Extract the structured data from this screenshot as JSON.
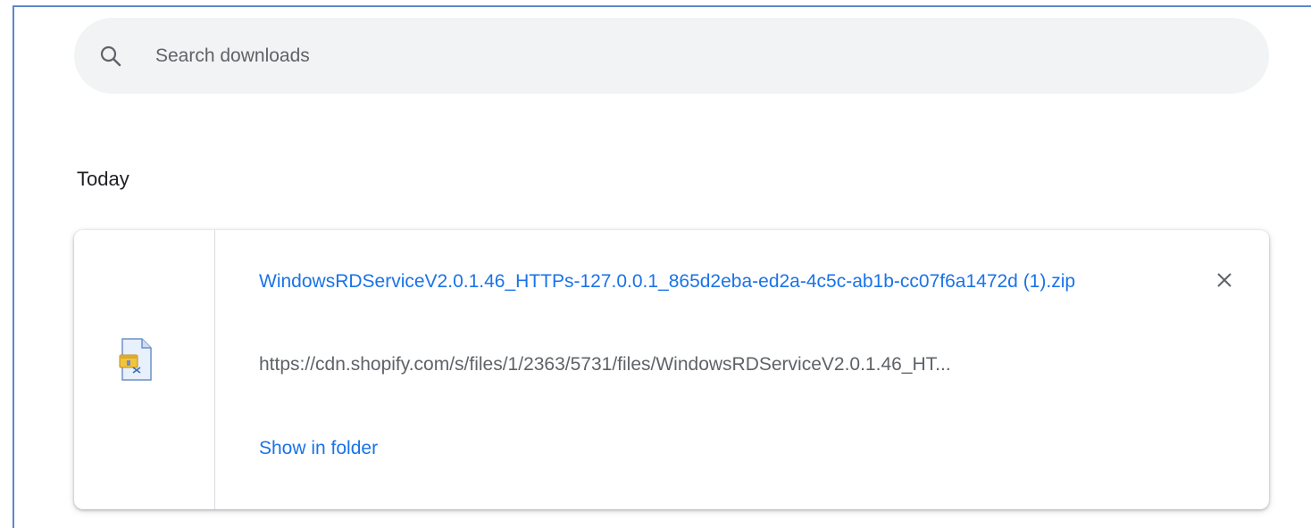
{
  "search": {
    "placeholder": "Search downloads",
    "icon": "search-icon"
  },
  "section": {
    "heading": "Today"
  },
  "downloads": [
    {
      "file_name": "WindowsRDServiceV2.0.1.46_HTTPs-127.0.0.1_865d2eba-ed2a-4c5c-ab1b-cc07f6a1472d (1).zip",
      "url": "https://cdn.shopify.com/s/files/1/2363/5731/files/WindowsRDServiceV2.0.1.46_HT...",
      "action_label": "Show in folder",
      "file_icon": "zip-file-icon",
      "close_icon": "close-icon"
    }
  ],
  "colors": {
    "link": "#1a73e8",
    "secondary_text": "#5f6368",
    "search_bg": "#f1f3f4",
    "frame_border": "#5b87c9"
  }
}
